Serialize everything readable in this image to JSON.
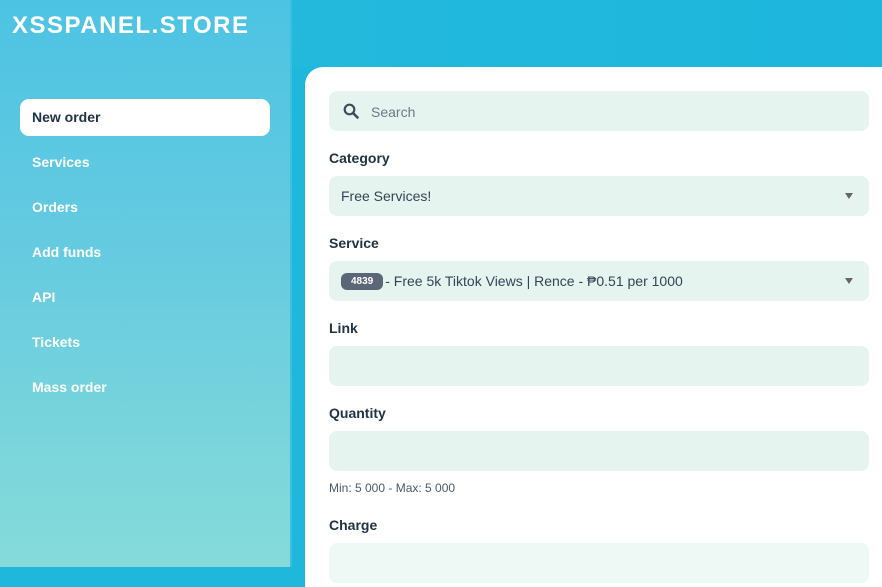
{
  "brand": {
    "title": "XSSPANEL.STORE"
  },
  "sidebar": {
    "items": [
      {
        "label": "New order",
        "active": true
      },
      {
        "label": "Services"
      },
      {
        "label": "Orders"
      },
      {
        "label": "Add funds"
      },
      {
        "label": "API"
      },
      {
        "label": "Tickets"
      },
      {
        "label": "Mass order"
      }
    ]
  },
  "form": {
    "search": {
      "placeholder": "Search",
      "icon": "search-icon"
    },
    "category": {
      "label": "Category",
      "value": "Free Services!"
    },
    "service": {
      "label": "Service",
      "id_badge": "4839",
      "value": "- Free 5k Tiktok Views | Rence - ₱0.51 per 1000"
    },
    "link": {
      "label": "Link",
      "value": ""
    },
    "quantity": {
      "label": "Quantity",
      "value": "",
      "hint": "Min: 5 000 - Max: 5 000"
    },
    "charge": {
      "label": "Charge",
      "value": ""
    }
  },
  "colors": {
    "accent": "#1fb8dc",
    "field_bg": "#e6f4ef",
    "text_dark": "#223344",
    "badge_bg": "#5b6776"
  }
}
